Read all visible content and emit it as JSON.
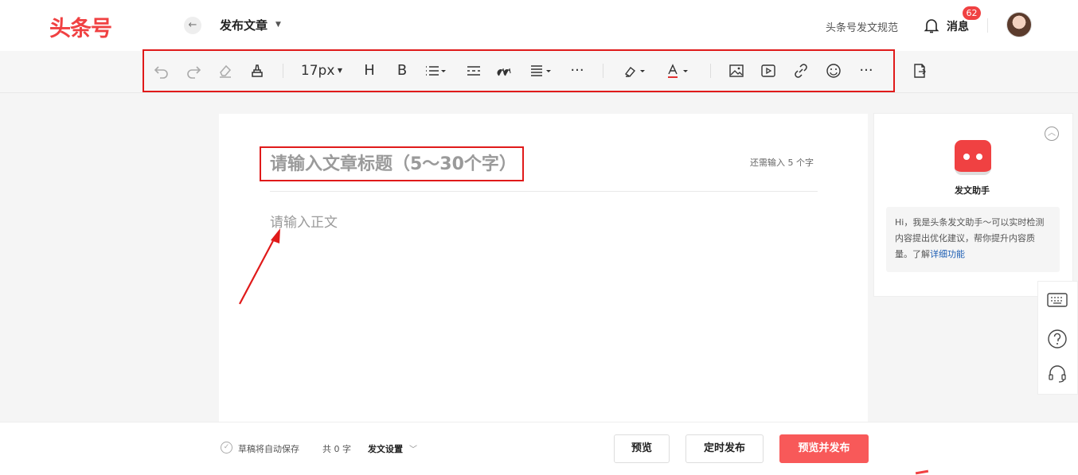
{
  "header": {
    "logo": "头条号",
    "page_title": "发布文章",
    "rules_link": "头条号发文规范",
    "messages_label": "消息",
    "messages_badge": "62"
  },
  "toolbar": {
    "font_size": "17px",
    "heading_label": "H",
    "bold_label": "B",
    "more_label": "···"
  },
  "editor": {
    "title_placeholder": "请输入文章标题（5～30个字）",
    "remaining_hint": "还需输入 5 个字",
    "body_placeholder": "请输入正文"
  },
  "assistant": {
    "name": "发文助手",
    "intro": "Hi，我是头条发文助手～可以实时检测内容提出优化建议，帮你提升内容质量。了解",
    "more_link": "详细功能"
  },
  "footer": {
    "autosave": "草稿将自动保存",
    "word_count": "共 0 字",
    "settings": "发文设置",
    "preview_button": "预览",
    "schedule_button": "定时发布",
    "publish_button": "预览并发布"
  },
  "colors": {
    "brand": "#f04142",
    "primary_button": "#f85959",
    "annotation": "#e01a1a",
    "link": "#1e5fb4"
  },
  "icons": [
    "back-icon",
    "bell-icon",
    "undo-icon",
    "redo-icon",
    "eraser-icon",
    "format-painter-icon",
    "list-icon",
    "divider-icon",
    "quote-icon",
    "align-icon",
    "highlight-icon",
    "font-color-icon",
    "image-icon",
    "video-icon",
    "link-icon",
    "emoji-icon",
    "import-doc-icon",
    "keyboard-icon",
    "help-icon",
    "headset-icon",
    "collapse-icon",
    "check-circle-icon"
  ]
}
